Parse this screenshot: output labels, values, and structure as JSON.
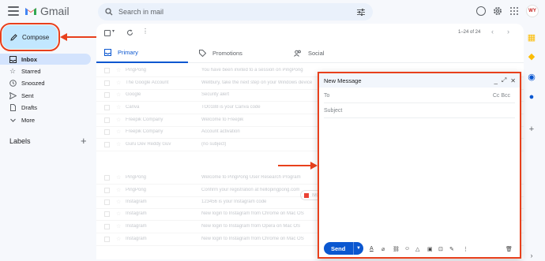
{
  "app": {
    "name": "Gmail",
    "avatar_initials": "WY"
  },
  "search": {
    "placeholder": "Search in mail"
  },
  "compose": {
    "label": "Compose"
  },
  "sidebar": {
    "items": [
      {
        "label": "Inbox",
        "icon": "inbox-icon",
        "active": true
      },
      {
        "label": "Starred",
        "icon": "star-icon"
      },
      {
        "label": "Snoozed",
        "icon": "clock-icon"
      },
      {
        "label": "Sent",
        "icon": "send-icon"
      },
      {
        "label": "Drafts",
        "icon": "draft-icon"
      },
      {
        "label": "More",
        "icon": "chevron-down-icon"
      }
    ],
    "labels_heading": "Labels"
  },
  "toolbar": {
    "pagination": "1–24 of 24"
  },
  "tabs": [
    {
      "label": "Primary",
      "icon": "inbox-icon",
      "active": true
    },
    {
      "label": "Promotions",
      "icon": "tag-icon"
    },
    {
      "label": "Social",
      "icon": "people-icon"
    }
  ],
  "emails": [
    {
      "sender": "PingPong",
      "subject": "You have been invited to a session on PingPong"
    },
    {
      "sender": "The Google Account",
      "subject": "Wellbury, take the next step on your Windows device"
    },
    {
      "sender": "Google",
      "subject": "Security alert"
    },
    {
      "sender": "Canva",
      "subject": "TO0188 is your Canva code"
    },
    {
      "sender": "Freepik Company",
      "subject": "Welcome to Freepik"
    },
    {
      "sender": "Freepik Company",
      "subject": "Account activation"
    },
    {
      "sender": "Guru Dev Reddy Guv",
      "subject": "(no subject)"
    },
    {
      "sender": "PingPong",
      "subject": "Welcome to PingPong User Research Program"
    },
    {
      "sender": "PingPong",
      "subject": "Confirm your registration at hellopingpong.com"
    },
    {
      "sender": "Instagram",
      "subject": "123456 is your Instagram code"
    },
    {
      "sender": "Instagram",
      "subject": "New login to Instagram from Chrome on Mac OS"
    },
    {
      "sender": "Instagram",
      "subject": "New login to Instagram from Opera on Mac OS"
    },
    {
      "sender": "Instagram",
      "subject": "New login to Instagram from Chrome on Mac OS"
    }
  ],
  "attachment": {
    "name": "IMG_20220908..."
  },
  "compose_window": {
    "title": "New Message",
    "to_label": "To",
    "cc_bcc": "Cc Bcc",
    "subject_placeholder": "Subject",
    "send_label": "Send"
  },
  "colors": {
    "accent": "#0b57d0",
    "highlight": "#e8401c",
    "compose_bg": "#c2e7ff",
    "active_nav": "#d3e3fd"
  }
}
